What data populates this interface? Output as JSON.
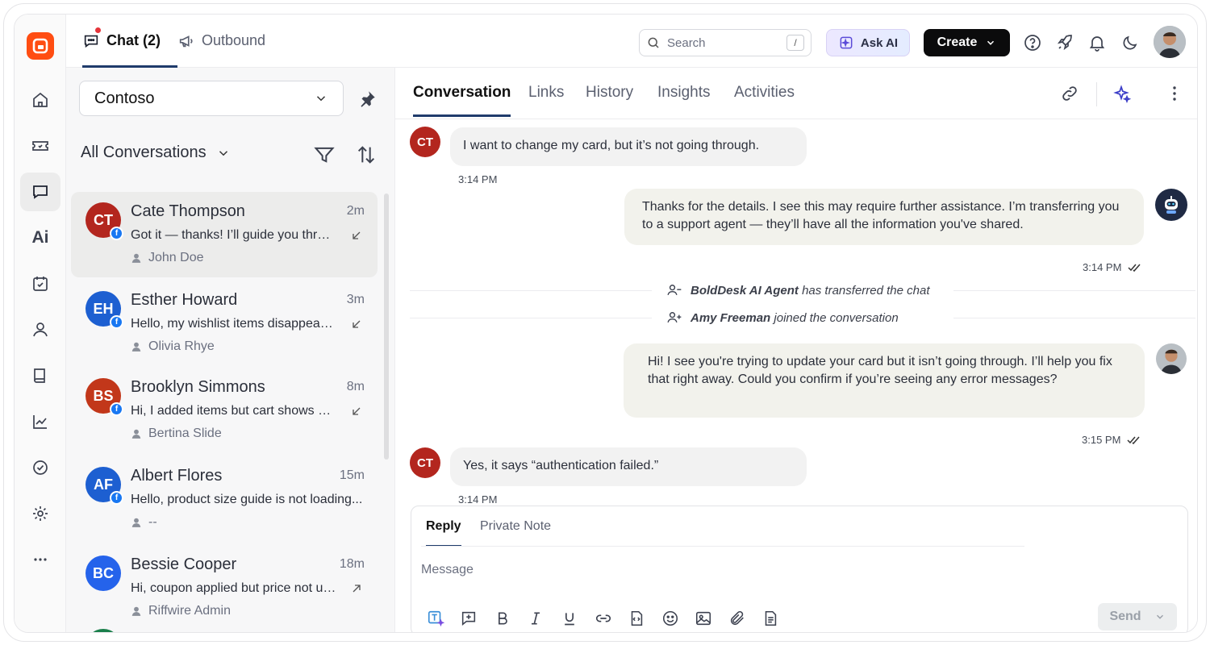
{
  "header": {
    "tabs": [
      {
        "label": "Chat (2)",
        "icon": "chat-bubble-icon",
        "active": true,
        "has_notification_dot": true
      },
      {
        "label": "Outbound",
        "icon": "megaphone-icon",
        "active": false
      }
    ],
    "search": {
      "placeholder": "Search",
      "shortcut": "/"
    },
    "ask_ai_label": "Ask AI",
    "create_label": "Create",
    "icons": [
      "help-icon",
      "rocket-icon",
      "bell-icon",
      "moon-icon",
      "user-avatar"
    ]
  },
  "sidebar": {
    "items": [
      {
        "name": "home",
        "icon": "home-icon"
      },
      {
        "name": "tickets",
        "icon": "ticket-icon"
      },
      {
        "name": "chat",
        "icon": "chat-icon",
        "active": true
      },
      {
        "name": "ai",
        "icon": "ai-icon",
        "label": "Ai"
      },
      {
        "name": "tasks",
        "icon": "calendar-check-icon"
      },
      {
        "name": "contacts",
        "icon": "person-icon"
      },
      {
        "name": "knowledge-base",
        "icon": "book-icon"
      },
      {
        "name": "reports",
        "icon": "chart-line-icon"
      },
      {
        "name": "activities",
        "icon": "check-circle-icon"
      },
      {
        "name": "settings",
        "icon": "gear-icon"
      },
      {
        "name": "more",
        "icon": "more-horizontal-icon"
      }
    ]
  },
  "list": {
    "brand": "Contoso",
    "view_label": "All Conversations",
    "conversations": [
      {
        "initials": "CT",
        "name": "Cate Thompson",
        "time": "2m",
        "preview": "Got it — thanks! I’ll guide you through...",
        "agent": "John Doe",
        "color": "#b3261e",
        "direction": "incoming",
        "selected": true
      },
      {
        "initials": "EH",
        "name": "Esther Howard",
        "time": "3m",
        "preview": "Hello, my wishlist items disappeared...",
        "agent": "Olivia Rhye",
        "color": "#1d5fd1",
        "direction": "incoming",
        "selected": false
      },
      {
        "initials": "BS",
        "name": "Brooklyn Simmons",
        "time": "8m",
        "preview": "Hi, I added items but cart shows empty...",
        "agent": "Bertina Slide",
        "color": "#c2371a",
        "direction": "incoming",
        "selected": false
      },
      {
        "initials": "AF",
        "name": "Albert Flores",
        "time": "15m",
        "preview": "Hello, product size guide is not loading...",
        "agent": "--",
        "color": "#1d5fd1",
        "direction": "none",
        "selected": false
      },
      {
        "initials": "BC",
        "name": "Bessie Cooper",
        "time": "18m",
        "preview": "Hi, coupon applied but price not updated...",
        "agent": "Riffwire Admin",
        "color": "#2563eb",
        "direction": "outgoing",
        "selected": false
      }
    ]
  },
  "main": {
    "tabs": [
      "Conversation",
      "Links",
      "History",
      "Insights",
      "Activities"
    ],
    "active_tab": "Conversation",
    "messages": [
      {
        "from": "customer",
        "initials": "CT",
        "text": "I want to change my card, but it’s not going through.",
        "time": "3:14 PM"
      },
      {
        "from": "bot",
        "text": "Thanks for the details. I see this may require further assistance. I’m transferring you to a support agent — they’ll have all the information you've shared.",
        "time": "3:14 PM"
      },
      {
        "from": "agent",
        "text": "Hi! I see you're trying to update your card but it isn’t going through. I’ll help you fix that right away. Could you confirm if you’re seeing any error messages?",
        "time": "3:15 PM"
      },
      {
        "from": "customer",
        "initials": "CT",
        "text": "Yes, it says “authentication failed.”",
        "time": "3:14 PM"
      }
    ],
    "system_events": [
      {
        "actor": "BoldDesk AI Agent",
        "text": "has transferred the chat",
        "icon": "person-minus-icon"
      },
      {
        "actor": "Amy Freeman",
        "text": "joined the conversation",
        "icon": "person-plus-icon"
      }
    ]
  },
  "composer": {
    "tabs": [
      "Reply",
      "Private Note"
    ],
    "active_tab": "Reply",
    "placeholder": "Message",
    "send_label": "Send",
    "tools": [
      "ai-text-icon",
      "add-comment-icon",
      "bold-icon",
      "italic-icon",
      "underline-icon",
      "link-icon",
      "code-file-icon",
      "emoji-icon",
      "image-icon",
      "attachment-icon",
      "document-icon"
    ]
  },
  "colors": {
    "brand": "#ff4d12",
    "accent_underline": "#1f3b6b",
    "facebook": "#1877f2"
  }
}
